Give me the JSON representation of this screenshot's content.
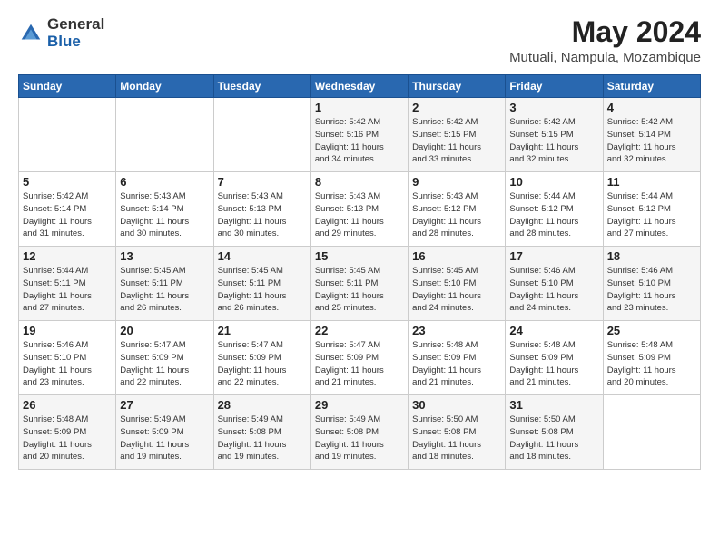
{
  "logo": {
    "general": "General",
    "blue": "Blue"
  },
  "title": "May 2024",
  "subtitle": "Mutuali, Nampula, Mozambique",
  "weekdays": [
    "Sunday",
    "Monday",
    "Tuesday",
    "Wednesday",
    "Thursday",
    "Friday",
    "Saturday"
  ],
  "weeks": [
    [
      {
        "day": "",
        "info": ""
      },
      {
        "day": "",
        "info": ""
      },
      {
        "day": "",
        "info": ""
      },
      {
        "day": "1",
        "info": "Sunrise: 5:42 AM\nSunset: 5:16 PM\nDaylight: 11 hours\nand 34 minutes."
      },
      {
        "day": "2",
        "info": "Sunrise: 5:42 AM\nSunset: 5:15 PM\nDaylight: 11 hours\nand 33 minutes."
      },
      {
        "day": "3",
        "info": "Sunrise: 5:42 AM\nSunset: 5:15 PM\nDaylight: 11 hours\nand 32 minutes."
      },
      {
        "day": "4",
        "info": "Sunrise: 5:42 AM\nSunset: 5:14 PM\nDaylight: 11 hours\nand 32 minutes."
      }
    ],
    [
      {
        "day": "5",
        "info": "Sunrise: 5:42 AM\nSunset: 5:14 PM\nDaylight: 11 hours\nand 31 minutes."
      },
      {
        "day": "6",
        "info": "Sunrise: 5:43 AM\nSunset: 5:14 PM\nDaylight: 11 hours\nand 30 minutes."
      },
      {
        "day": "7",
        "info": "Sunrise: 5:43 AM\nSunset: 5:13 PM\nDaylight: 11 hours\nand 30 minutes."
      },
      {
        "day": "8",
        "info": "Sunrise: 5:43 AM\nSunset: 5:13 PM\nDaylight: 11 hours\nand 29 minutes."
      },
      {
        "day": "9",
        "info": "Sunrise: 5:43 AM\nSunset: 5:12 PM\nDaylight: 11 hours\nand 28 minutes."
      },
      {
        "day": "10",
        "info": "Sunrise: 5:44 AM\nSunset: 5:12 PM\nDaylight: 11 hours\nand 28 minutes."
      },
      {
        "day": "11",
        "info": "Sunrise: 5:44 AM\nSunset: 5:12 PM\nDaylight: 11 hours\nand 27 minutes."
      }
    ],
    [
      {
        "day": "12",
        "info": "Sunrise: 5:44 AM\nSunset: 5:11 PM\nDaylight: 11 hours\nand 27 minutes."
      },
      {
        "day": "13",
        "info": "Sunrise: 5:45 AM\nSunset: 5:11 PM\nDaylight: 11 hours\nand 26 minutes."
      },
      {
        "day": "14",
        "info": "Sunrise: 5:45 AM\nSunset: 5:11 PM\nDaylight: 11 hours\nand 26 minutes."
      },
      {
        "day": "15",
        "info": "Sunrise: 5:45 AM\nSunset: 5:11 PM\nDaylight: 11 hours\nand 25 minutes."
      },
      {
        "day": "16",
        "info": "Sunrise: 5:45 AM\nSunset: 5:10 PM\nDaylight: 11 hours\nand 24 minutes."
      },
      {
        "day": "17",
        "info": "Sunrise: 5:46 AM\nSunset: 5:10 PM\nDaylight: 11 hours\nand 24 minutes."
      },
      {
        "day": "18",
        "info": "Sunrise: 5:46 AM\nSunset: 5:10 PM\nDaylight: 11 hours\nand 23 minutes."
      }
    ],
    [
      {
        "day": "19",
        "info": "Sunrise: 5:46 AM\nSunset: 5:10 PM\nDaylight: 11 hours\nand 23 minutes."
      },
      {
        "day": "20",
        "info": "Sunrise: 5:47 AM\nSunset: 5:09 PM\nDaylight: 11 hours\nand 22 minutes."
      },
      {
        "day": "21",
        "info": "Sunrise: 5:47 AM\nSunset: 5:09 PM\nDaylight: 11 hours\nand 22 minutes."
      },
      {
        "day": "22",
        "info": "Sunrise: 5:47 AM\nSunset: 5:09 PM\nDaylight: 11 hours\nand 21 minutes."
      },
      {
        "day": "23",
        "info": "Sunrise: 5:48 AM\nSunset: 5:09 PM\nDaylight: 11 hours\nand 21 minutes."
      },
      {
        "day": "24",
        "info": "Sunrise: 5:48 AM\nSunset: 5:09 PM\nDaylight: 11 hours\nand 21 minutes."
      },
      {
        "day": "25",
        "info": "Sunrise: 5:48 AM\nSunset: 5:09 PM\nDaylight: 11 hours\nand 20 minutes."
      }
    ],
    [
      {
        "day": "26",
        "info": "Sunrise: 5:48 AM\nSunset: 5:09 PM\nDaylight: 11 hours\nand 20 minutes."
      },
      {
        "day": "27",
        "info": "Sunrise: 5:49 AM\nSunset: 5:09 PM\nDaylight: 11 hours\nand 19 minutes."
      },
      {
        "day": "28",
        "info": "Sunrise: 5:49 AM\nSunset: 5:08 PM\nDaylight: 11 hours\nand 19 minutes."
      },
      {
        "day": "29",
        "info": "Sunrise: 5:49 AM\nSunset: 5:08 PM\nDaylight: 11 hours\nand 19 minutes."
      },
      {
        "day": "30",
        "info": "Sunrise: 5:50 AM\nSunset: 5:08 PM\nDaylight: 11 hours\nand 18 minutes."
      },
      {
        "day": "31",
        "info": "Sunrise: 5:50 AM\nSunset: 5:08 PM\nDaylight: 11 hours\nand 18 minutes."
      },
      {
        "day": "",
        "info": ""
      }
    ]
  ]
}
